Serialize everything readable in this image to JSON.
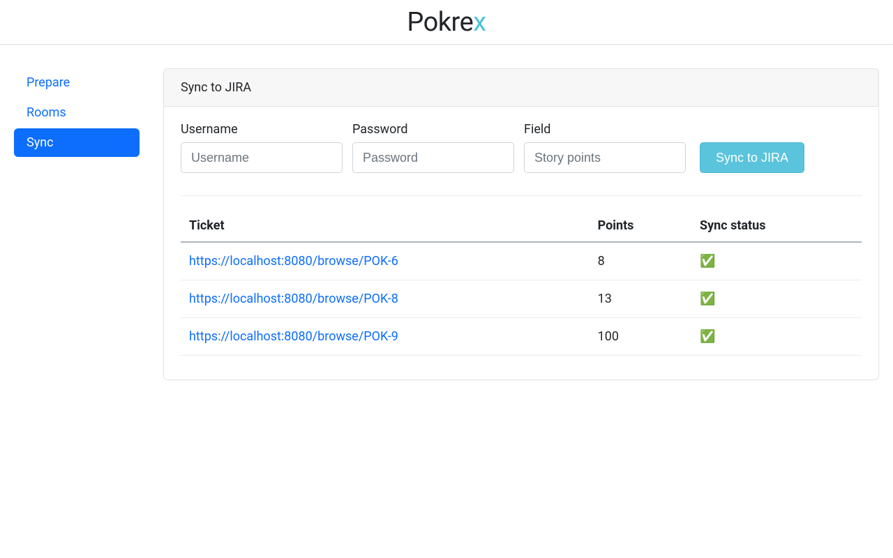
{
  "brand": {
    "name": "Pokre",
    "accent": "x"
  },
  "sidebar": {
    "items": [
      {
        "label": "Prepare",
        "active": false
      },
      {
        "label": "Rooms",
        "active": false
      },
      {
        "label": "Sync",
        "active": true
      }
    ]
  },
  "card": {
    "title": "Sync to JIRA",
    "form": {
      "username": {
        "label": "Username",
        "placeholder": "Username",
        "value": ""
      },
      "password": {
        "label": "Password",
        "placeholder": "Password",
        "value": ""
      },
      "field": {
        "label": "Field",
        "placeholder": "Story points",
        "value": ""
      },
      "submit_label": "Sync to JIRA"
    },
    "table": {
      "headers": {
        "ticket": "Ticket",
        "points": "Points",
        "status": "Sync status"
      },
      "rows": [
        {
          "ticket": "https://localhost:8080/browse/POK-6",
          "points": "8",
          "status": "✅"
        },
        {
          "ticket": "https://localhost:8080/browse/POK-8",
          "points": "13",
          "status": "✅"
        },
        {
          "ticket": "https://localhost:8080/browse/POK-9",
          "points": "100",
          "status": "✅"
        }
      ]
    }
  }
}
